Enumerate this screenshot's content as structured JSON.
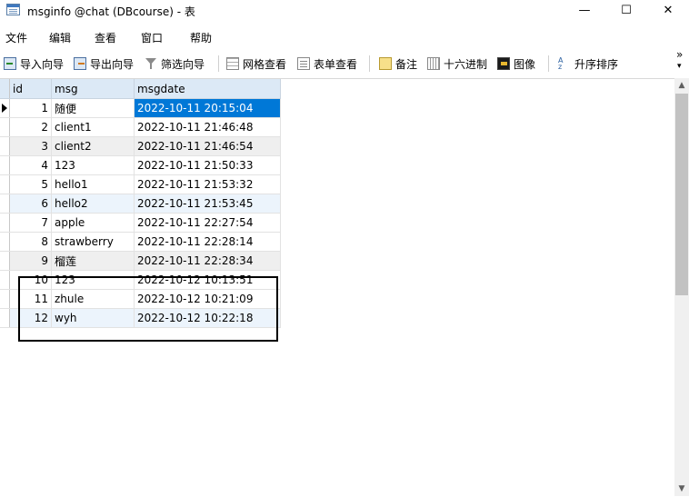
{
  "window": {
    "title": "msginfo @chat (DBcourse) - 表",
    "minimize": "—",
    "maximize": "☐",
    "close": "✕"
  },
  "menu": [
    "文件",
    "编辑",
    "查看",
    "窗口",
    "帮助"
  ],
  "toolbar": {
    "import_wizard": "导入向导",
    "export_wizard": "导出向导",
    "filter_wizard": "筛选向导",
    "grid_view": "网格查看",
    "form_view": "表单查看",
    "memo": "备注",
    "hex": "十六进制",
    "image": "图像",
    "sort_asc": "升序排序",
    "overflow_top": "»",
    "overflow_bottom": "▾"
  },
  "grid": {
    "columns": [
      "id",
      "msg",
      "msgdate"
    ],
    "rows": [
      {
        "id": "1",
        "msg": "随便",
        "msgdate": "2022-10-11 20:15:04"
      },
      {
        "id": "2",
        "msg": "client1",
        "msgdate": "2022-10-11 21:46:48"
      },
      {
        "id": "3",
        "msg": "client2",
        "msgdate": "2022-10-11 21:46:54"
      },
      {
        "id": "4",
        "msg": "123",
        "msgdate": "2022-10-11 21:50:33"
      },
      {
        "id": "5",
        "msg": "hello1",
        "msgdate": "2022-10-11 21:53:32"
      },
      {
        "id": "6",
        "msg": "hello2",
        "msgdate": "2022-10-11 21:53:45"
      },
      {
        "id": "7",
        "msg": "apple",
        "msgdate": "2022-10-11 22:27:54"
      },
      {
        "id": "8",
        "msg": "strawberry",
        "msgdate": "2022-10-11 22:28:14"
      },
      {
        "id": "9",
        "msg": "榴莲",
        "msgdate": "2022-10-11 22:28:34"
      },
      {
        "id": "10",
        "msg": "123",
        "msgdate": "2022-10-12 10:13:51"
      },
      {
        "id": "11",
        "msg": "zhule",
        "msgdate": "2022-10-12 10:21:09"
      },
      {
        "id": "12",
        "msg": "wyh",
        "msgdate": "2022-10-12 10:22:18"
      }
    ]
  },
  "scroll": {
    "up": "▲",
    "down": "▼"
  }
}
